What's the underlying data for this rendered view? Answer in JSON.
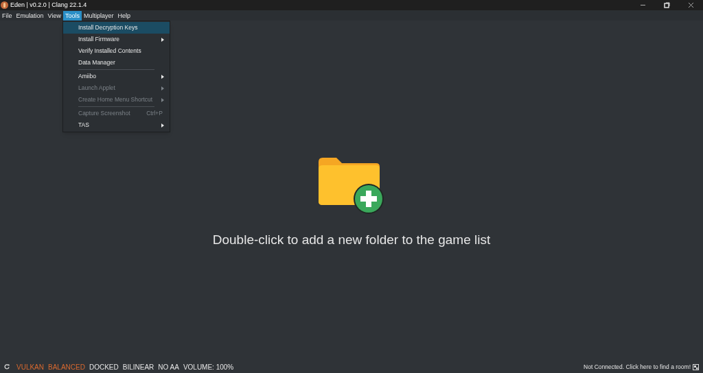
{
  "window": {
    "title": "Eden | v0.2.0 | Clang 22.1.4"
  },
  "menubar": [
    {
      "label": "File",
      "selected": false
    },
    {
      "label": "Emulation",
      "selected": false
    },
    {
      "label": "View",
      "selected": false
    },
    {
      "label": "Tools",
      "selected": true
    },
    {
      "label": "Multiplayer",
      "selected": false
    },
    {
      "label": "Help",
      "selected": false
    }
  ],
  "dropdown": [
    {
      "kind": "item",
      "label": "Install Decryption Keys",
      "selected": true,
      "disabled": false,
      "submenu": false
    },
    {
      "kind": "item",
      "label": "Install Firmware",
      "selected": false,
      "disabled": false,
      "submenu": true
    },
    {
      "kind": "item",
      "label": "Verify Installed Contents",
      "selected": false,
      "disabled": false,
      "submenu": false
    },
    {
      "kind": "item",
      "label": "Data Manager",
      "selected": false,
      "disabled": false,
      "submenu": false
    },
    {
      "kind": "separator"
    },
    {
      "kind": "item",
      "label": "Amiibo",
      "selected": false,
      "disabled": false,
      "submenu": true
    },
    {
      "kind": "item",
      "label": "Launch Applet",
      "selected": false,
      "disabled": true,
      "submenu": true
    },
    {
      "kind": "item",
      "label": "Create Home Menu Shortcut",
      "selected": false,
      "disabled": true,
      "submenu": true
    },
    {
      "kind": "separator"
    },
    {
      "kind": "item",
      "label": "Capture Screenshot",
      "shortcut": "Ctrl+P",
      "selected": false,
      "disabled": true,
      "submenu": false
    },
    {
      "kind": "item",
      "label": "TAS",
      "selected": false,
      "disabled": false,
      "submenu": true
    }
  ],
  "game_list": {
    "message": "Double-click to add a new folder to the game list"
  },
  "status_bar": {
    "items": [
      {
        "label": "VULKAN",
        "color": "#d9692f"
      },
      {
        "label": "BALANCED",
        "color": "#d9692f"
      },
      {
        "label": "DOCKED",
        "color": "#e6e6e6"
      },
      {
        "label": "BILINEAR",
        "color": "#e6e6e6"
      },
      {
        "label": "NO AA",
        "color": "#e6e6e6"
      },
      {
        "label": "VOLUME: 100%",
        "color": "#e6e6e6"
      }
    ],
    "network": "Not Connected. Click here to find a room!"
  }
}
